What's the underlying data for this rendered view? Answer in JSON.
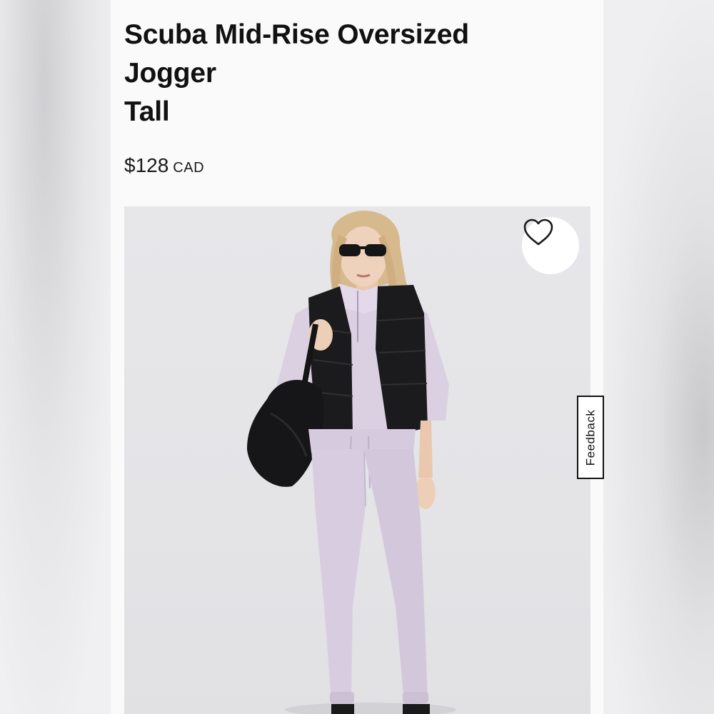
{
  "product": {
    "title_lines": [
      "Scuba Mid-Rise Oversized",
      "Jogger",
      "Tall"
    ],
    "price": "$128",
    "currency": "CAD"
  },
  "image": {
    "alt": "Model wearing lilac Scuba jogger and hoodie with black puffer vest, sunglasses and black shoulder bag"
  },
  "wishlist": {
    "icon": "heart-outline-icon"
  },
  "feedback": {
    "label": "Feedback"
  },
  "colors": {
    "page_background": "#fafafa",
    "image_background": "#e5e5e8",
    "text": "#111111",
    "jogger_lilac": "#d8cde0",
    "vest_black": "#1b1b1d"
  }
}
